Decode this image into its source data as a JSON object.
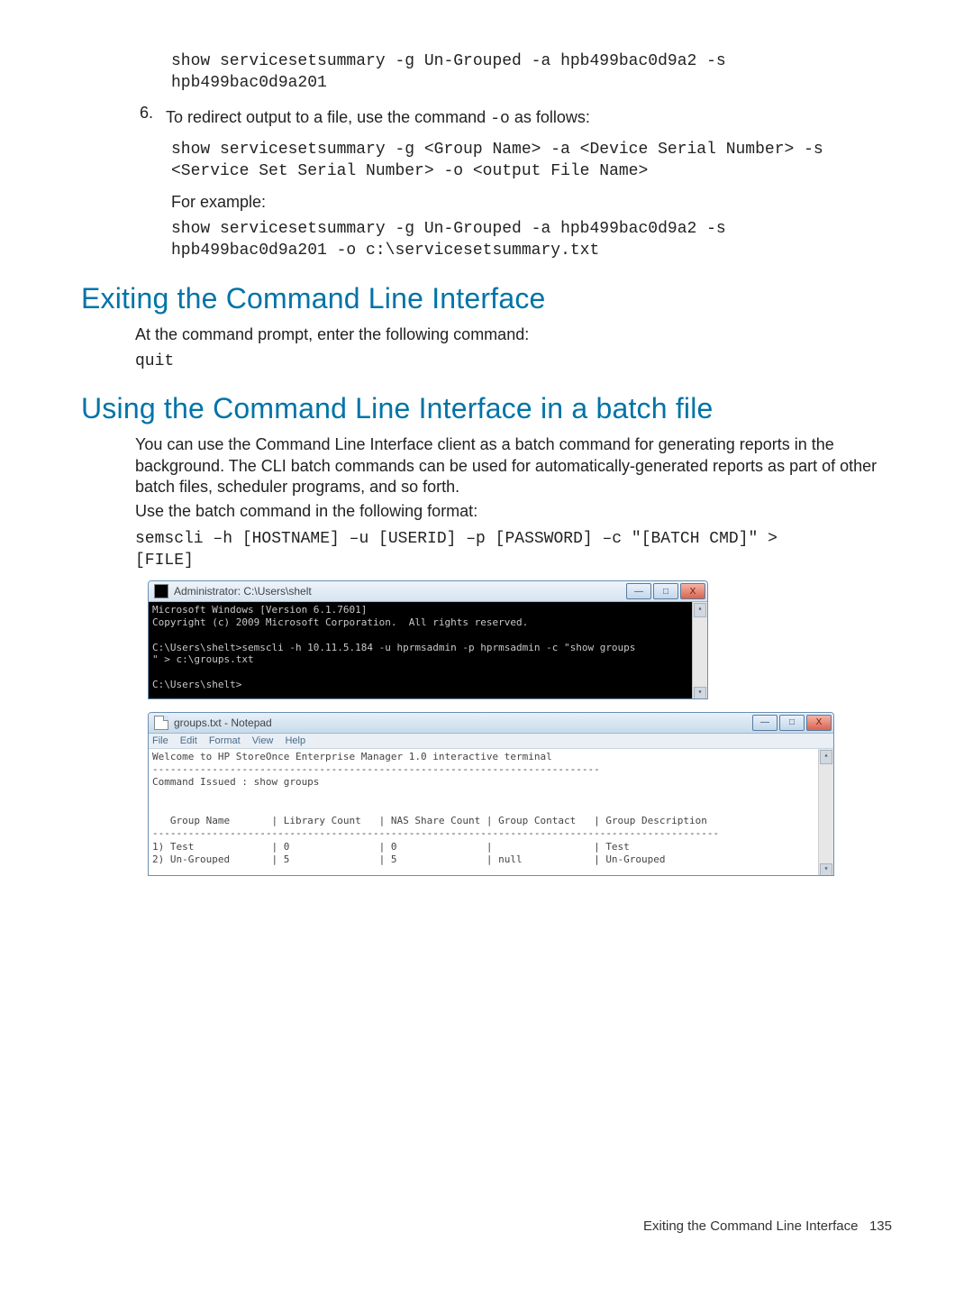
{
  "block1": {
    "code_a": "show servicesetsummary -g Un-Grouped -a hpb499bac0d9a2 -s\nhpb499bac0d9a201",
    "num": "6.",
    "step_pre": "To redirect output to a file, use the command ",
    "step_flag": "-o",
    "step_post": " as follows:",
    "code_b": "show servicesetsummary -g <Group Name> -a <Device Serial Number> -s\n<Service Set Serial Number> -o <output File Name>",
    "eg_label": "For example:",
    "code_c": "show servicesetsummary -g Un-Grouped -a hpb499bac0d9a2 -s\nhpb499bac0d9a201 -o c:\\servicesetsummary.txt"
  },
  "h_exit": "Exiting the Command Line Interface",
  "exit": {
    "p": "At the command prompt, enter the following command:",
    "code": "quit"
  },
  "h_batch": "Using the Command Line Interface in a batch file",
  "batch": {
    "p1": "You can use the Command Line Interface client as a batch command for generating reports in the background. The CLI batch commands can be used for automatically-generated reports as part of other batch files, scheduler programs, and so forth.",
    "p2": "Use the batch command in the following format:",
    "code": "semscli –h [HOSTNAME] –u [USERID] –p [PASSWORD] –c \"[BATCH CMD]\" >\n[FILE]"
  },
  "cmdwin": {
    "title": "Administrator: C:\\Users\\shelt",
    "content": "Microsoft Windows [Version 6.1.7601]\nCopyright (c) 2009 Microsoft Corporation.  All rights reserved.\n\nC:\\Users\\shelt>semscli -h 10.11.5.184 -u hprmsadmin -p hprmsadmin -c \"show groups\n\" > c:\\groups.txt\n\nC:\\Users\\shelt>",
    "min": "—",
    "max": "□",
    "close": "X"
  },
  "notepad": {
    "title": "groups.txt - Notepad",
    "menu": {
      "file": "File",
      "edit": "Edit",
      "format": "Format",
      "view": "View",
      "help": "Help"
    },
    "content": "Welcome to HP StoreOnce Enterprise Manager 1.0 interactive terminal\n---------------------------------------------------------------------------\nCommand Issued : show groups\n\n\n   Group Name       | Library Count   | NAS Share Count | Group Contact   | Group Description\n-----------------------------------------------------------------------------------------------\n1) Test             | 0               | 0               |                 | Test\n2) Un-Grouped       | 5               | 5               | null            | Un-Grouped",
    "min": "—",
    "max": "□",
    "close": "X"
  },
  "footer": {
    "text": "Exiting the Command Line Interface",
    "page": "135"
  }
}
